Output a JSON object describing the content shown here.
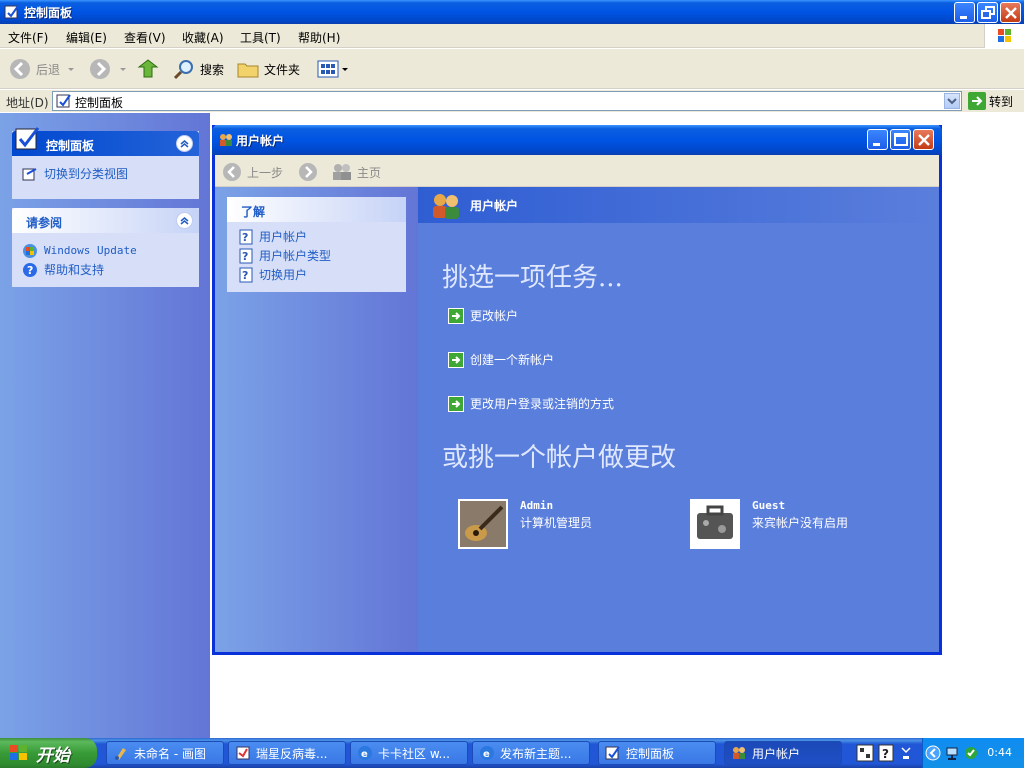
{
  "control_panel": {
    "title": "控制面板",
    "menu": [
      "文件(F)",
      "编辑(E)",
      "查看(V)",
      "收藏(A)",
      "工具(T)",
      "帮助(H)"
    ],
    "toolbar": {
      "back": "后退",
      "search": "搜索",
      "folders": "文件夹"
    },
    "address": {
      "label": "地址(D)",
      "value": "控制面板",
      "go": "转到"
    },
    "taskpane": {
      "panel_title": "控制面板",
      "switch_view": "切换到分类视图",
      "see_also_title": "请参阅",
      "windows_update": "Windows Update",
      "help_support": "帮助和支持"
    }
  },
  "user_accounts": {
    "title": "用户帐户",
    "nav": {
      "back": "上一步",
      "home": "主页"
    },
    "learn": {
      "title": "了解",
      "items": [
        "用户帐户",
        "用户帐户类型",
        "切换用户"
      ]
    },
    "banner": "用户帐户",
    "pick_task": "挑选一项任务...",
    "tasks": [
      "更改帐户",
      "创建一个新帐户",
      "更改用户登录或注销的方式"
    ],
    "pick_account": "或挑一个帐户做更改",
    "accounts": [
      {
        "name": "Admin",
        "desc": "计算机管理员"
      },
      {
        "name": "Guest",
        "desc": "来宾帐户没有启用"
      }
    ]
  },
  "taskbar": {
    "start": "开始",
    "buttons": [
      "未命名 - 画图",
      "瑞星反病毒...",
      "卡卡社区 w...",
      "发布新主题...",
      "控制面板",
      "用户帐户"
    ],
    "clock": "0:44"
  },
  "colors": {
    "xp_blue": "#0054e3",
    "taskpane": "#6375d6",
    "start_green": "#379b37"
  }
}
